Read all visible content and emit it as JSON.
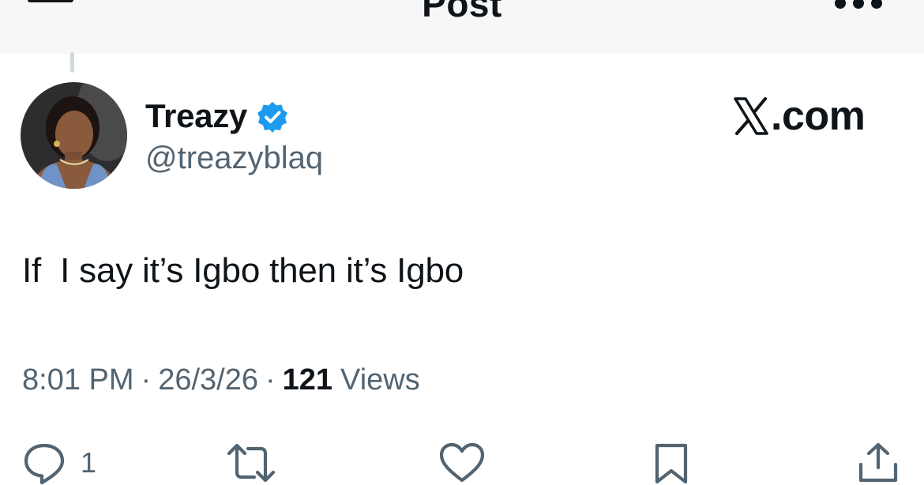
{
  "header": {
    "title": "Post"
  },
  "author": {
    "display_name": "Treazy",
    "handle": "@treazyblaq",
    "verified": true
  },
  "brand": {
    "suffix": ".com"
  },
  "tweet": {
    "text": "If  I say it’s Igbo then it’s Igbo"
  },
  "meta": {
    "time": "8:01 PM",
    "date": "26/3/26",
    "separator": "·",
    "views_count": "121",
    "views_label": "Views"
  },
  "actions": {
    "reply": {
      "icon": "reply-icon",
      "count": "1"
    },
    "repost": {
      "icon": "repost-icon"
    },
    "like": {
      "icon": "heart-icon"
    },
    "bookmark": {
      "icon": "bookmark-icon"
    },
    "share": {
      "icon": "share-icon"
    }
  },
  "colors": {
    "text": "#0f1419",
    "secondary": "#536471",
    "verified": "#1d9bf0",
    "header_bg": "#f7f7f8",
    "thread_line": "#cfd9de"
  }
}
